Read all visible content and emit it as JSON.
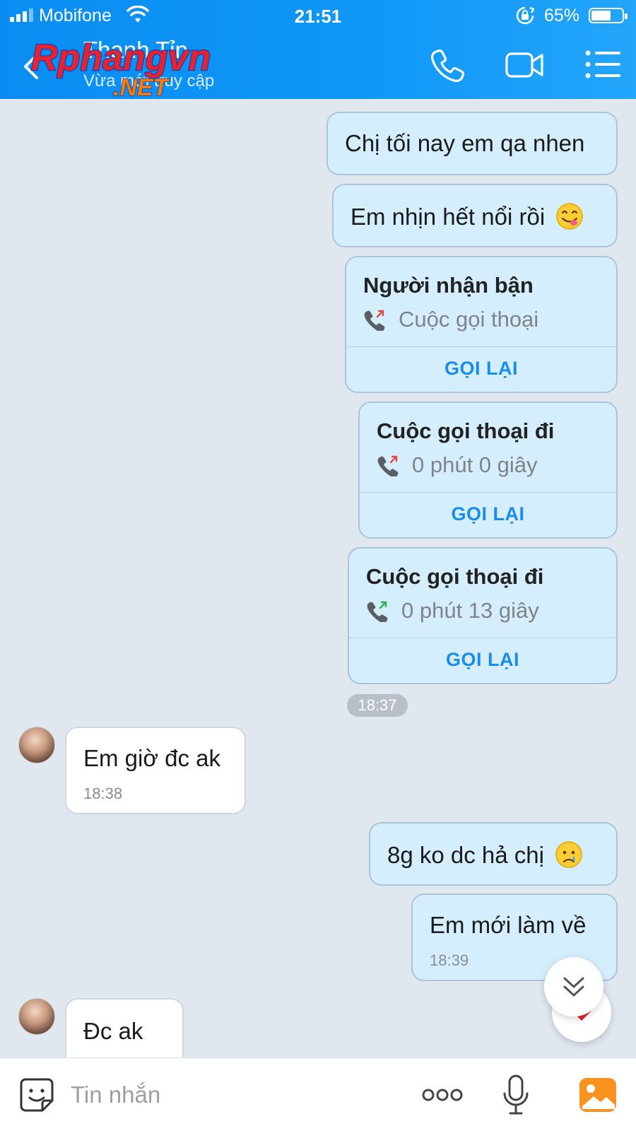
{
  "status_bar": {
    "carrier": "Mobifone",
    "time": "21:51",
    "battery_percent": "65%",
    "battery_level": 0.65
  },
  "header": {
    "contact_name": "Thanh Tỉn",
    "contact_status": "Vừa mới truy cập",
    "watermark": {
      "main": "Rphangvn",
      "sub": ".NET"
    },
    "icons": {
      "back": "chevron-left-icon",
      "call": "phone-icon",
      "video": "video-camera-icon",
      "menu": "list-menu-icon"
    }
  },
  "messages": {
    "m1": {
      "text": "Chị tối nay em qa nhen",
      "direction": "out"
    },
    "m2": {
      "text": "Em nhịn hết nổi rồi",
      "emoji": "yum-face-emoji",
      "direction": "out"
    },
    "call1": {
      "title": "Người nhận bận",
      "detail": "Cuộc gọi thoại",
      "action": "GỌI LẠI",
      "status_color": "#e8453c"
    },
    "call2": {
      "title": "Cuộc gọi thoại đi",
      "detail": "0 phút 0 giây",
      "action": "GỌI LẠI",
      "status_color": "#e8453c"
    },
    "call3": {
      "title": "Cuộc gọi thoại đi",
      "detail": "0 phút 13 giây",
      "action": "GỌI LẠI",
      "status_color": "#2bb24c"
    },
    "group_time": "18:37",
    "m3": {
      "text": "Em giờ đc ak",
      "time": "18:38",
      "direction": "in"
    },
    "m4": {
      "text": "8g ko dc hả chị",
      "emoji": "crying-face-emoji",
      "direction": "out"
    },
    "m5": {
      "text": "Em mới làm về",
      "time": "18:39",
      "direction": "out"
    },
    "m6": {
      "text": "Đc  ak",
      "direction": "in"
    }
  },
  "composer": {
    "placeholder": "Tin nhắn",
    "value": ""
  },
  "colors": {
    "header": "#0f96f6",
    "chat_background": "#e1e7ef",
    "outgoing_bubble": "#d4eefd",
    "incoming_bubble": "#ffffff",
    "link_blue": "#1a8ceb",
    "photo_button": "#f7931e"
  }
}
